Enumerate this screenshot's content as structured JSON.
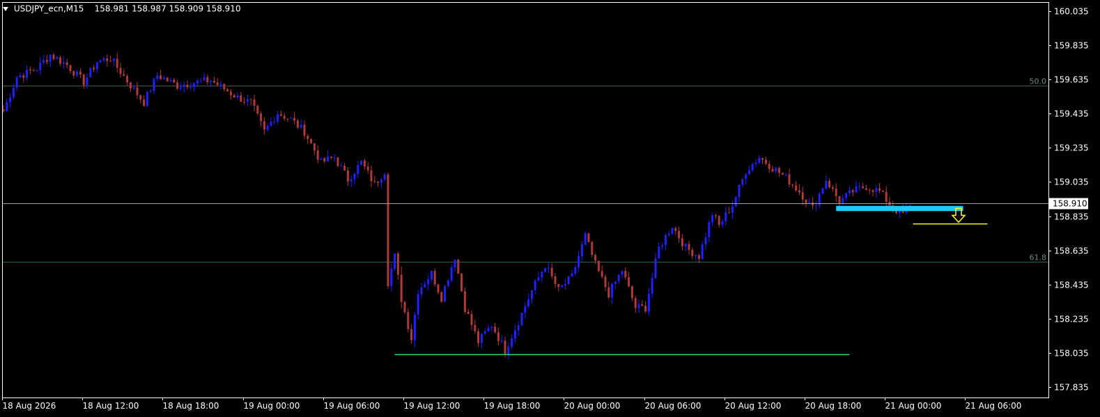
{
  "header": {
    "symbol": "USDJPY_ecn,M15",
    "ohlc": "158.981 158.987 158.909 158.910"
  },
  "chart_data": {
    "type": "candlestick",
    "symbol": "USDJPY_ecn",
    "timeframe": "M15",
    "ylim": [
      157.735,
      160.1
    ],
    "y_ticks": [
      "160.035",
      "159.835",
      "159.635",
      "159.435",
      "159.235",
      "159.035",
      "158.835",
      "158.635",
      "158.435",
      "158.235",
      "158.035",
      "157.835"
    ],
    "x_ticks": [
      "18 Aug 2026",
      "18 Aug 12:00",
      "18 Aug 18:00",
      "19 Aug 00:00",
      "19 Aug 06:00",
      "19 Aug 12:00",
      "19 Aug 18:00",
      "20 Aug 00:00",
      "20 Aug 06:00",
      "20 Aug 12:00",
      "20 Aug 18:00",
      "21 Aug 00:00",
      "21 Aug 06:00"
    ],
    "current_price": "158.910",
    "colors": {
      "bull": "#1f1fff",
      "bear": "#b03a3a",
      "grid_line": "#2f5f52",
      "bid_line": "#a0a0a0",
      "zone": "#1ec8ff",
      "target": "#ffff00",
      "support": "#2fd67a"
    },
    "fib_levels": [
      {
        "label": "50.0",
        "price": 159.6
      },
      {
        "label": "61.8",
        "price": 158.57
      }
    ],
    "zone": {
      "from_bar": 249,
      "to_bar": 287,
      "price_top": 158.895,
      "price_bottom": 158.865
    },
    "target_line": {
      "from_bar": 272,
      "to_bar": 293,
      "price": 158.79
    },
    "support_line": {
      "from_bar": 117,
      "to_bar": 253,
      "price": 158.025
    },
    "arrow": {
      "bar": 285,
      "price": 158.84,
      "direction": "down"
    },
    "anchors": [
      [
        0,
        159.45
      ],
      [
        4,
        159.65
      ],
      [
        10,
        159.7
      ],
      [
        14,
        159.78
      ],
      [
        19,
        159.72
      ],
      [
        24,
        159.62
      ],
      [
        28,
        159.74
      ],
      [
        32,
        159.76
      ],
      [
        38,
        159.6
      ],
      [
        42,
        159.5
      ],
      [
        46,
        159.66
      ],
      [
        52,
        159.6
      ],
      [
        58,
        159.62
      ],
      [
        62,
        159.63
      ],
      [
        66,
        159.58
      ],
      [
        70,
        159.53
      ],
      [
        74,
        159.5
      ],
      [
        78,
        159.33
      ],
      [
        82,
        159.44
      ],
      [
        86,
        159.4
      ],
      [
        90,
        159.33
      ],
      [
        95,
        159.15
      ],
      [
        99,
        159.18
      ],
      [
        103,
        159.05
      ],
      [
        107,
        159.15
      ],
      [
        111,
        159.02
      ],
      [
        114,
        159.1
      ],
      [
        115,
        158.45
      ],
      [
        117,
        158.6
      ],
      [
        119,
        158.35
      ],
      [
        122,
        158.12
      ],
      [
        124,
        158.4
      ],
      [
        128,
        158.5
      ],
      [
        131,
        158.36
      ],
      [
        135,
        158.6
      ],
      [
        138,
        158.3
      ],
      [
        142,
        158.1
      ],
      [
        146,
        158.2
      ],
      [
        150,
        158.05
      ],
      [
        154,
        158.22
      ],
      [
        158,
        158.4
      ],
      [
        162,
        158.55
      ],
      [
        166,
        158.4
      ],
      [
        170,
        158.48
      ],
      [
        174,
        158.72
      ],
      [
        177,
        158.55
      ],
      [
        181,
        158.38
      ],
      [
        185,
        158.52
      ],
      [
        189,
        158.3
      ],
      [
        192,
        158.3
      ],
      [
        196,
        158.65
      ],
      [
        200,
        158.78
      ],
      [
        204,
        158.65
      ],
      [
        208,
        158.6
      ],
      [
        212,
        158.85
      ],
      [
        214,
        158.78
      ],
      [
        218,
        158.9
      ],
      [
        222,
        159.1
      ],
      [
        226,
        159.18
      ],
      [
        230,
        159.12
      ],
      [
        234,
        159.06
      ],
      [
        238,
        158.98
      ],
      [
        242,
        158.88
      ],
      [
        246,
        159.05
      ],
      [
        250,
        158.92
      ],
      [
        254,
        158.98
      ],
      [
        258,
        159.01
      ],
      [
        262,
        158.98
      ],
      [
        266,
        158.88
      ],
      [
        269,
        158.85
      ],
      [
        271,
        158.9
      ]
    ]
  }
}
